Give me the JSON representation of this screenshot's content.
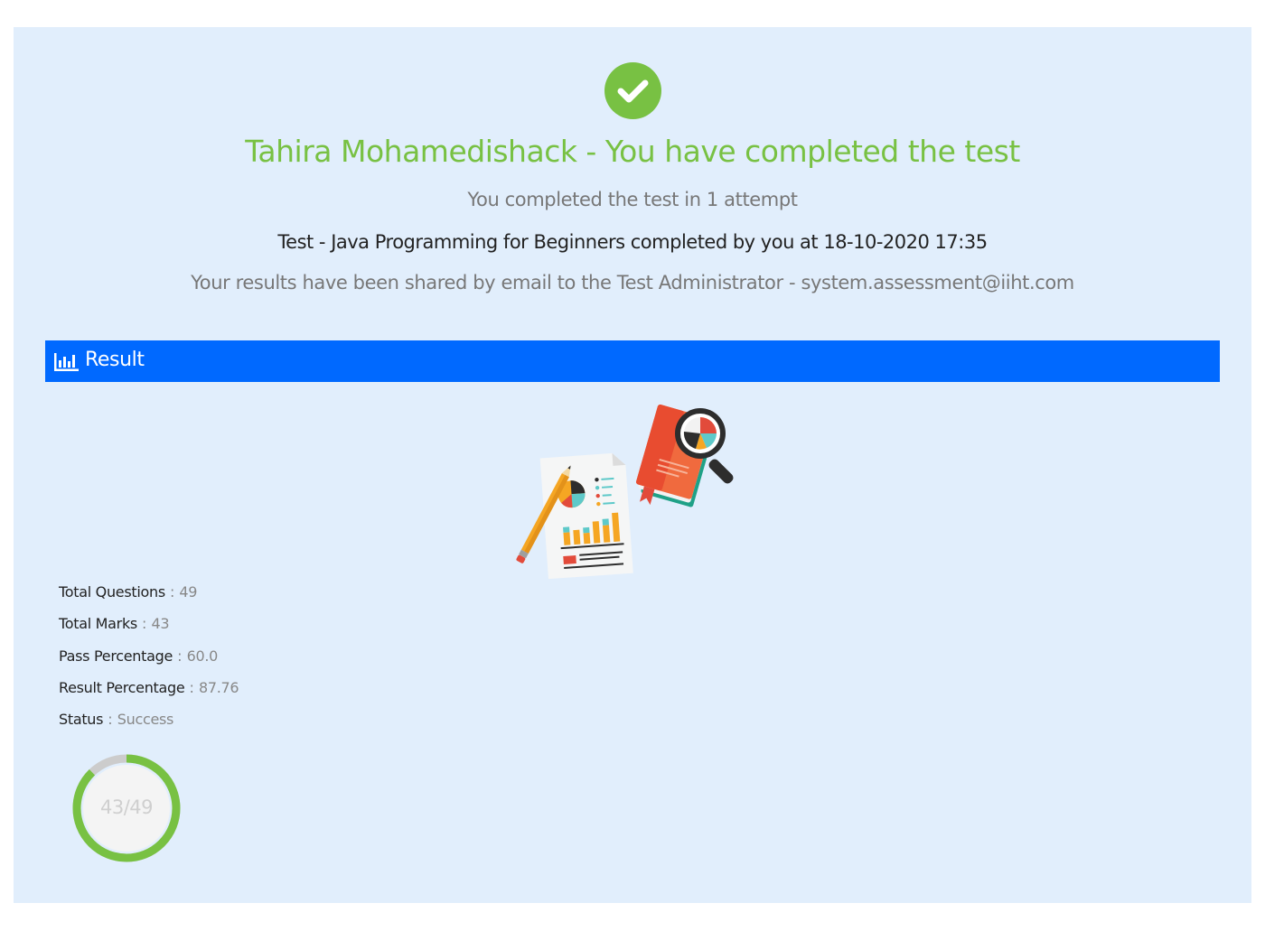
{
  "header": {
    "title": "Tahira Mohamedishack - You have completed the test",
    "attempt_line": "You completed the test in 1 attempt",
    "completed_line": "Test - Java Programming for Beginners completed by you at 18-10-2020 17:35",
    "shared_line": "Your results have been shared by email to the Test Administrator - system.assessment@iiht.com"
  },
  "result_section": {
    "heading": "Result",
    "icon": "bar-chart-icon"
  },
  "stats": [
    {
      "label": "Total Questions",
      "value": "49"
    },
    {
      "label": "Total Marks",
      "value": "43"
    },
    {
      "label": "Pass Percentage",
      "value": "60.0"
    },
    {
      "label": "Result Percentage",
      "value": "87.76"
    },
    {
      "label": "Status",
      "value": "Success"
    }
  ],
  "score": {
    "text": "43/49",
    "obtained": 43,
    "total": 49
  },
  "colors": {
    "success": "#78c143",
    "accent": "#0069ff",
    "panel_bg": "#e1eefc"
  },
  "icons": {
    "status": "check-circle-icon",
    "illustration": "report-analysis-illustration"
  }
}
